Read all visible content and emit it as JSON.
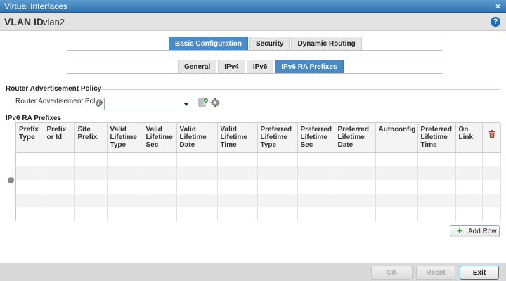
{
  "window": {
    "title": "Virtual Interfaces",
    "close_glyph": "×"
  },
  "vlan": {
    "label": "VLAN ID",
    "value": "vlan2",
    "help_glyph": "?"
  },
  "main_tabs": [
    {
      "label": "Basic Configuration",
      "active": true
    },
    {
      "label": "Security",
      "active": false
    },
    {
      "label": "Dynamic Routing",
      "active": false
    }
  ],
  "sub_tabs": [
    {
      "label": "General",
      "active": false
    },
    {
      "label": "IPv4",
      "active": false
    },
    {
      "label": "IPv6",
      "active": false
    },
    {
      "label": "IPv6 RA Prefixes",
      "active": true
    }
  ],
  "router_advertisement": {
    "section_title": "Router Advertisement Policy",
    "field_label": "Router Advertisement Policy",
    "selected_value": ""
  },
  "prefixes": {
    "section_title": "IPv6 RA Prefixes",
    "columns": [
      "Prefix Type",
      "Prefix or Id",
      "Site Prefix",
      "Valid Lifetime Type",
      "Valid Lifetime Sec",
      "Valid Lifetime Date",
      "Valid Lifetime Time",
      "Preferred Lifetime Type",
      "Preferred Lifetime Sec",
      "Preferred Lifetime Date",
      "Autoconfig",
      "Preferred Lifetime Time",
      "On Link"
    ],
    "rows": [],
    "add_row_label": "Add Row"
  },
  "footer": {
    "ok_label": "OK",
    "reset_label": "Reset",
    "exit_label": "Exit"
  },
  "colors": {
    "accent": "#4a8ac6",
    "titlebar": "#2f73b2",
    "delete": "#c0392b",
    "add": "#2e9b2e"
  },
  "icons": [
    "close-icon",
    "help-icon",
    "info-icon",
    "chevron-down-icon",
    "create-policy-icon",
    "edit-policy-icon",
    "trash-icon",
    "plus-icon"
  ]
}
